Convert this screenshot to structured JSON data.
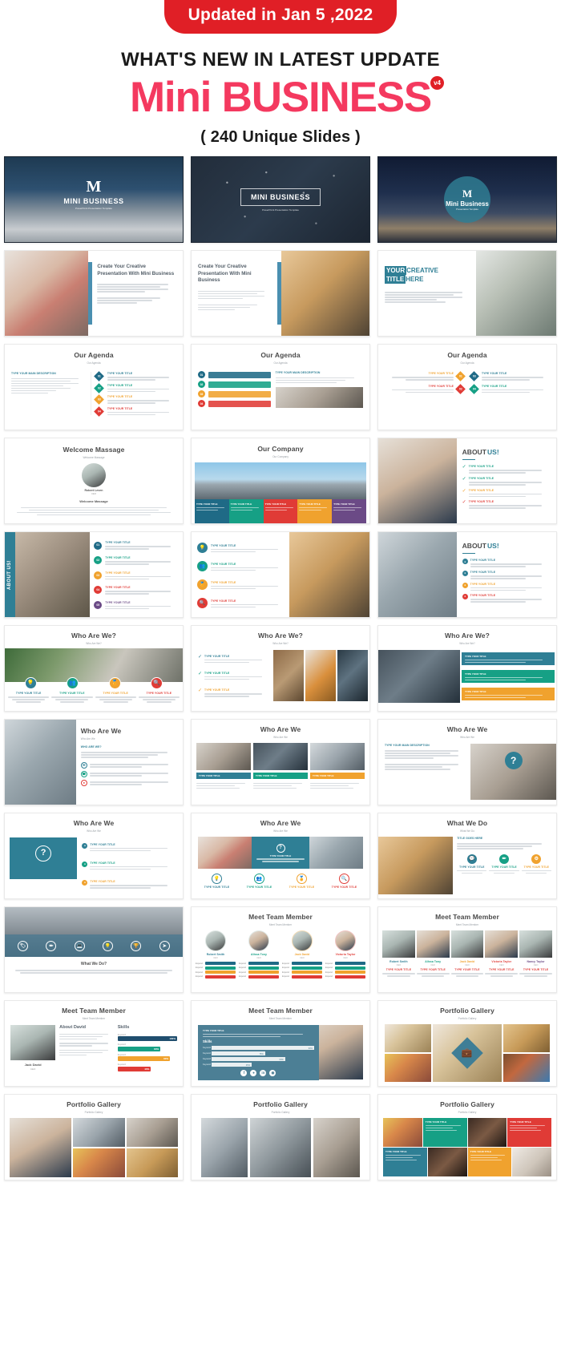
{
  "header": {
    "update_badge": "Updated in Jan 5 ,2022",
    "headline": "WHAT'S NEW IN LATEST UPDATE",
    "brand_first": "Mini ",
    "brand_second": "BUSINESS",
    "version_badge": "v4",
    "slide_count": "( 240 Unique Slides )",
    "accent_red": "#e01f26",
    "accent_pink": "#f4395f",
    "accent_teal": "#2f7f95"
  },
  "common": {
    "type_your_title": "TYPE YOUR TITLE",
    "type_your_main_description": "TYPE YOUR MAIN DESCRIPTION",
    "who_are_we_q": "WHO ARE WE?",
    "title_goes_here": "TITLE GOES HERE",
    "skills": "Skills",
    "numbers": [
      "01",
      "02",
      "03",
      "04",
      "05"
    ],
    "percents": [
      "100%",
      "80%",
      "60%",
      "40%"
    ]
  },
  "slides": [
    {
      "id": "cover-mountain",
      "title": "MINI BUSINESS",
      "subtitle": "PowerPoint Presentation Template"
    },
    {
      "id": "cover-network",
      "title": "MINI BUSINESS",
      "subtitle": "PowerPoint Presentation Template"
    },
    {
      "id": "cover-night",
      "title": "Mini Business",
      "subtitle": "Presentation Template"
    },
    {
      "id": "create-presentation-left",
      "title": "Create Your Creative Presentation With Mini Business",
      "body": "This is a sample text and here you can edit your own text. Use it for describing your own concept in your way and then fill learn for your topic and make it simple so much as you can then it better."
    },
    {
      "id": "create-presentation-right",
      "title": "Create Your Creative Presentation With Mini Business",
      "body": "This is a sample text and here you can edit your own text. Use it for describing your own concept in your way and then fill learn for your topic and make it simple so much as you can then it better."
    },
    {
      "id": "your-creative-title-here",
      "title_part1": "YOUR",
      "title_part2": "CREATIVE",
      "title_part3": "TITLE",
      "title_part4": "HERE",
      "body": "This is a sample text and here you can edit your own text. Use it for describing your own concept in your way."
    },
    {
      "id": "our-agenda-1",
      "title": "Our Agenda",
      "subtitle": "Our Agenda",
      "left_heading": "TYPE YOUR MAIN DESCRIPTION",
      "items": [
        {
          "num": "01",
          "label": "TYPE YOUR TITLE",
          "color": "#1f6a86"
        },
        {
          "num": "02",
          "label": "TYPE YOUR TITLE",
          "color": "#16a085"
        },
        {
          "num": "03",
          "label": "TYPE YOUR TITLE",
          "color": "#f0a22e"
        },
        {
          "num": "04",
          "label": "TYPE YOUR TITLE",
          "color": "#e03b36"
        }
      ]
    },
    {
      "id": "our-agenda-2",
      "title": "Our Agenda",
      "subtitle": "Our Agenda",
      "right_heading": "TYPE YOUR MAIN DESCRIPTION",
      "items": [
        {
          "num": "01",
          "label": "TYPE YOUR TITLE",
          "color": "#1f6a86"
        },
        {
          "num": "02",
          "label": "TYPE YOUR TITLE",
          "color": "#16a085"
        },
        {
          "num": "03",
          "label": "TYPE YOUR TITLE",
          "color": "#f0a22e"
        },
        {
          "num": "04",
          "label": "TYPE YOUR TITLE",
          "color": "#e03b36"
        }
      ]
    },
    {
      "id": "our-agenda-3",
      "title": "Our Agenda",
      "subtitle": "Our Agenda",
      "items": [
        {
          "num": "01",
          "label": "TYPE YOUR TITLE",
          "color": "#f0a22e"
        },
        {
          "num": "02",
          "label": "TYPE YOUR TITLE",
          "color": "#e03b36"
        },
        {
          "num": "03",
          "label": "TYPE YOUR TITLE",
          "color": "#1f6a86"
        },
        {
          "num": "04",
          "label": "TYPE YOUR TITLE",
          "color": "#16a085"
        }
      ]
    },
    {
      "id": "welcome-massage",
      "title": "Welcome Massage",
      "subtitle": "Welcome Massage",
      "person_name": "Robert Leven",
      "person_role": "CEO",
      "section_label": "Welcome Massage",
      "body": "There are many variations of passages of Lorem Ipsum available, but the majority have suffered alteration in some form, by injected humour. If you are going to use a passage of Lorem Ipsum, you need to be sure there isn't anything embarrassing hidden in the middle of text."
    },
    {
      "id": "our-company",
      "title": "Our Company",
      "subtitle": "Our Company",
      "columns": [
        {
          "label": "TYPE YOUR TITLE",
          "color": "#1f6a86"
        },
        {
          "label": "TYPE YOUR TITLE",
          "color": "#16a085"
        },
        {
          "label": "TYPE YOUR TITLE",
          "color": "#e03b36"
        },
        {
          "label": "TYPE YOUR TITLE",
          "color": "#f0a22e"
        },
        {
          "label": "TYPE YOUR TITLE",
          "color": "#6b4a86"
        }
      ]
    },
    {
      "id": "about-us-1",
      "title_part1": "ABOUT",
      "title_part2": "US!",
      "items": [
        {
          "label": "TYPE YOUR TITLE",
          "color": "#16a085"
        },
        {
          "label": "TYPE YOUR TITLE",
          "color": "#16a085"
        },
        {
          "label": "TYPE YOUR TITLE",
          "color": "#f0a22e"
        },
        {
          "label": "TYPE YOUR TITLE",
          "color": "#e03b36"
        }
      ]
    },
    {
      "id": "about-us-vertical",
      "side_label": "ABOUT US!",
      "items": [
        {
          "num": "01",
          "label": "TYPE YOUR TITLE",
          "color": "#1f6a86"
        },
        {
          "num": "02",
          "label": "TYPE YOUR TITLE",
          "color": "#16a085"
        },
        {
          "num": "03",
          "label": "TYPE YOUR TITLE",
          "color": "#f0a22e"
        },
        {
          "num": "04",
          "label": "TYPE YOUR TITLE",
          "color": "#e03b36"
        },
        {
          "num": "05",
          "label": "TYPE YOUR TITLE",
          "color": "#6b4a86"
        }
      ]
    },
    {
      "id": "about-us-icons",
      "items": [
        {
          "label": "TYPE YOUR TITLE",
          "color": "#1f6a86",
          "icon": "bulb-icon"
        },
        {
          "label": "TYPE YOUR TITLE",
          "color": "#16a085",
          "icon": "people-icon"
        },
        {
          "label": "TYPE YOUR TITLE",
          "color": "#f0a22e",
          "icon": "medal-icon"
        },
        {
          "label": "TYPE YOUR TITLE",
          "color": "#e03b36",
          "icon": "search-icon"
        }
      ]
    },
    {
      "id": "about-us-3",
      "title_part1": "ABOUT",
      "title_part2": "US!",
      "items": [
        {
          "label": "TYPE YOUR TITLE",
          "color": "#1f6a86"
        },
        {
          "label": "TYPE YOUR TITLE",
          "color": "#1f6a86"
        },
        {
          "label": "TYPE YOUR TITLE",
          "color": "#f0a22e"
        },
        {
          "label": "TYPE YOUR TITLE",
          "color": "#e03b36"
        }
      ]
    },
    {
      "id": "who-are-we-icons",
      "title": "Who Are We?",
      "subtitle": "Who Are We?",
      "items": [
        {
          "label": "TYPE YOUR TITLE",
          "color": "#2f7f95",
          "icon": "bulb-icon"
        },
        {
          "label": "TYPE YOUR TITLE",
          "color": "#16a085",
          "icon": "people-icon"
        },
        {
          "label": "TYPE YOUR TITLE",
          "color": "#f0a22e",
          "icon": "medal-icon"
        },
        {
          "label": "TYPE YOUR TITLE",
          "color": "#e03b36",
          "icon": "search-icon"
        }
      ]
    },
    {
      "id": "who-are-we-checks",
      "title": "Who Are We?",
      "subtitle": "Who Are We?",
      "items": [
        {
          "label": "TYPE YOUR TITLE",
          "color": "#2f7f95"
        },
        {
          "label": "TYPE YOUR TITLE",
          "color": "#16a085"
        },
        {
          "label": "TYPE YOUR TITLE",
          "color": "#f0a22e"
        }
      ]
    },
    {
      "id": "who-are-we-bars",
      "title": "Who Are We?",
      "subtitle": "Who Are We?",
      "items": [
        {
          "label": "TYPE YOUR TITLE",
          "color": "#2f7f95"
        },
        {
          "label": "TYPE YOUR TITLE",
          "color": "#16a085"
        },
        {
          "label": "TYPE YOUR TITLE",
          "color": "#f0a22e"
        }
      ]
    },
    {
      "id": "who-are-we-left-photo",
      "title": "Who Are We",
      "subtitle": "Who Are We",
      "heading": "WHO ARE WE?",
      "items": [
        {
          "label": "TYPE YOUR TITLE",
          "color": "#2f7f95"
        },
        {
          "label": "TYPE YOUR TITLE",
          "color": "#16a085"
        },
        {
          "label": "TYPE YOUR TITLE",
          "color": "#e03b36"
        }
      ]
    },
    {
      "id": "who-are-we-three-photo",
      "title": "Who Are We",
      "subtitle": "Who Are We",
      "items": [
        {
          "label": "TYPE YOUR TITLE",
          "color": "#2f7f95"
        },
        {
          "label": "TYPE YOUR TITLE",
          "color": "#16a085"
        },
        {
          "label": "TYPE YOUR TITLE",
          "color": "#f0a22e"
        }
      ]
    },
    {
      "id": "who-are-we-question",
      "title": "Who Are We",
      "subtitle": "Who Are We",
      "heading": "TYPE YOUR MAIN DESCRIPTION",
      "body": "There are many variations of passages of Lorem Ipsum available but the majority have suffered alteration in some form.",
      "question_mark": "?"
    },
    {
      "id": "who-are-we-qbox",
      "title": "Who Are We",
      "subtitle": "Who Are We",
      "question_mark": "?",
      "items": [
        {
          "label": "TYPE YOUR TITLE",
          "color": "#2f7f95"
        },
        {
          "label": "TYPE YOUR TITLE",
          "color": "#16a085"
        },
        {
          "label": "TYPE YOUR TITLE",
          "color": "#f0a22e"
        }
      ]
    },
    {
      "id": "who-are-we-banner",
      "title": "Who Are We",
      "subtitle": "Who Are We",
      "question_mark": "?",
      "banner_label": "TYPE YOUR TITLE",
      "items": [
        {
          "label": "TYPE YOUR TITLE",
          "color": "#2f7f95",
          "icon": "bulb-icon"
        },
        {
          "label": "TYPE YOUR TITLE",
          "color": "#16a085",
          "icon": "people-icon"
        },
        {
          "label": "TYPE YOUR TITLE",
          "color": "#f0a22e",
          "icon": "medal-icon"
        },
        {
          "label": "TYPE YOUR TITLE",
          "color": "#e03b36",
          "icon": "search-icon"
        }
      ]
    },
    {
      "id": "what-we-do-icons",
      "title": "What We Do",
      "subtitle": "What We Do",
      "heading": "TITLE GOES HERE",
      "items": [
        {
          "label": "TYPE YOUR TITLE",
          "color": "#2f7f95",
          "icon": "chat-icon"
        },
        {
          "label": "TYPE YOUR TITLE",
          "color": "#16a085",
          "icon": "pencil-icon"
        },
        {
          "label": "TYPE YOUR TITLE",
          "color": "#f0a22e",
          "icon": "gear-icon"
        }
      ]
    },
    {
      "id": "what-we-do-classroom",
      "heading": "What We Do?",
      "body": "There are many variations of passages of Lorem Ipsum available, but the majority have suffered alteration in some form, by injected humour or randomised words which don't look even slightly believable.",
      "icons": [
        "tag-icon",
        "pencil-icon",
        "laptop-icon",
        "bulb-icon",
        "trophy-icon",
        "send-icon"
      ]
    },
    {
      "id": "meet-team-member-4",
      "title": "Meet Team Member",
      "subtitle": "Meet Team Member",
      "members": [
        {
          "name": "Robert Smith",
          "role": "CEO"
        },
        {
          "name": "Allssa Tony",
          "role": "CEO"
        },
        {
          "name": "Jack David",
          "role": "CEO"
        },
        {
          "name": "Victoria Taylor",
          "role": "CEO"
        }
      ],
      "skill_label": "Expend",
      "skill_colors": [
        "#1f6a86",
        "#16a085",
        "#f0a22e",
        "#e03b36"
      ]
    },
    {
      "id": "meet-team-member-5",
      "title": "Meet Team Member",
      "subtitle": "Meet Team Member",
      "members": [
        {
          "name": "Robert Smith",
          "role": "CEO"
        },
        {
          "name": "Allssa Tony",
          "role": "CEO"
        },
        {
          "name": "Jack David",
          "role": "CEO"
        },
        {
          "name": "Victoria Taylor",
          "role": "CEO"
        },
        {
          "name": "Nancy Taylor",
          "role": "CEO"
        }
      ],
      "item_label": "TYPE YOUR TITLE"
    },
    {
      "id": "meet-team-about-david",
      "title": "Meet Team Member",
      "subtitle": "Meet Team Member",
      "person_name": "Jack David",
      "person_role": "CEO",
      "about_heading": "About David",
      "skills_heading": "Skills",
      "skills": [
        {
          "label": "Keyword",
          "value": "100%",
          "color": "#1f4e6e"
        },
        {
          "label": "Keyword",
          "value": "80%",
          "color": "#16a085"
        },
        {
          "label": "Keyword",
          "value": "60%",
          "color": "#f0a22e"
        },
        {
          "label": "Keyword",
          "value": "40%",
          "color": "#e03b36"
        }
      ]
    },
    {
      "id": "meet-team-skills-panel",
      "title": "Meet Team Member",
      "subtitle": "Meet Team Member",
      "panel_heading": "TYPE YOUR TITLE",
      "skills_heading": "Skills",
      "skills": [
        {
          "label": "Keyword",
          "value": "90%"
        },
        {
          "label": "Keyword",
          "value": "75%"
        },
        {
          "label": "Keyword",
          "value": "60%"
        },
        {
          "label": "Keyword",
          "value": "45%"
        }
      ],
      "social_icons": [
        "facebook-icon",
        "twitter-icon",
        "linkedin-icon",
        "instagram-icon"
      ]
    },
    {
      "id": "portfolio-gallery-diamond",
      "title": "Portfolio Gallery",
      "subtitle": "Portfolio Gallery",
      "center_icon": "briefcase-icon"
    },
    {
      "id": "portfolio-gallery-left",
      "title": "Portfolio Gallery",
      "subtitle": "Portfolio Gallery"
    },
    {
      "id": "portfolio-gallery-mid",
      "title": "Portfolio Gallery",
      "subtitle": "Portfolio Gallery"
    },
    {
      "id": "portfolio-gallery-color",
      "title": "Portfolio Gallery",
      "subtitle": "Portfolio Gallery",
      "tiles": [
        {
          "label": "TYPE YOUR TITLE",
          "color": "#16a085"
        },
        {
          "label": "TYPE YOUR TITLE",
          "color": "#e03b36"
        },
        {
          "label": "TYPE YOUR TITLE",
          "color": "#2f7f95"
        },
        {
          "label": "TYPE YOUR TITLE",
          "color": "#f0a22e"
        }
      ]
    }
  ]
}
